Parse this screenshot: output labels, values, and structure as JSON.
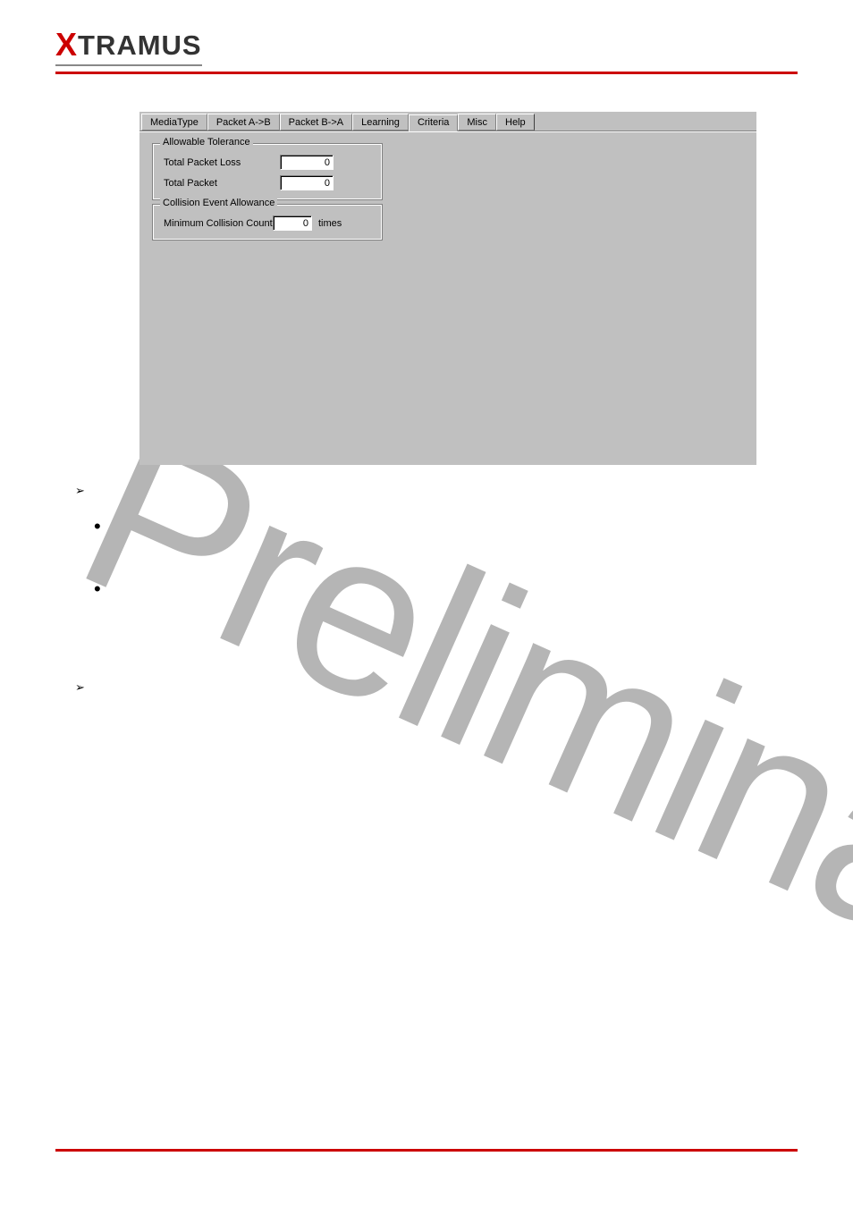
{
  "brand": {
    "x": "X",
    "rest": "TRAMUS"
  },
  "watermark": "Preliminary",
  "tabs": {
    "t0": "MediaType",
    "t1": "Packet A->B",
    "t2": "Packet B->A",
    "t3": "Learning",
    "t4": "Criteria",
    "t5": "Misc",
    "t6": "Help"
  },
  "groups": {
    "tolerance": {
      "legend": "Allowable Tolerance",
      "total_packet_loss_label": "Total Packet Loss",
      "total_packet_loss_value": "0",
      "total_packet_label": "Total Packet",
      "total_packet_value": "0"
    },
    "collision": {
      "legend": "Collision Event Allowance",
      "min_collision_label": "Minimum Collision Count",
      "min_collision_value": "0",
      "times_suffix": "times"
    }
  }
}
